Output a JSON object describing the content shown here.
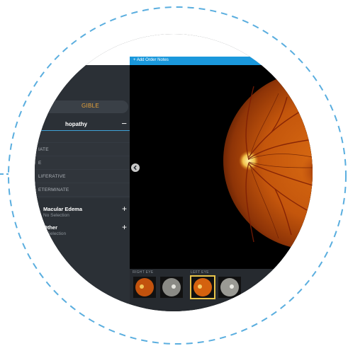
{
  "header": {
    "add_order_notes": "+ Add Order Notes"
  },
  "sidebar": {
    "ungradable_label": "GIBLE",
    "diabetic_section": {
      "title": "hopathy",
      "collapse_icon": "minus-icon",
      "options": [
        "",
        "IATE",
        "E",
        "LIFERATIVE",
        "ETERMINATE"
      ]
    },
    "groups": [
      {
        "title": "Macular Edema",
        "value": "No Selection"
      },
      {
        "title": "Other",
        "value": "o Selection"
      }
    ]
  },
  "thumbnails": {
    "right_eye_label": "RIGHT EYE",
    "left_eye_label": "LEFT EYE"
  },
  "colors": {
    "accent": "#1a98dc",
    "selected": "#e8c44a",
    "ungradable": "#e8a33a"
  }
}
